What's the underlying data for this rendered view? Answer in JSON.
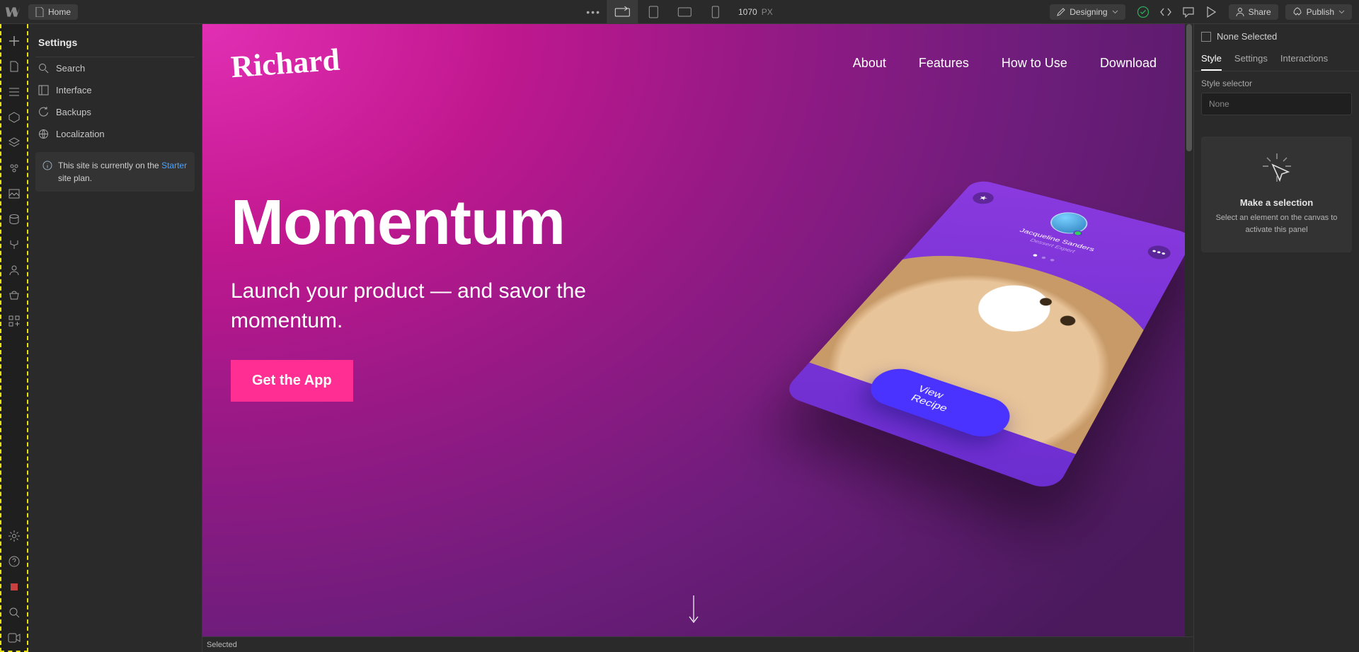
{
  "topbar": {
    "home_label": "Home",
    "breakpoint_value": "1070",
    "breakpoint_unit": "PX",
    "mode_label": "Designing",
    "share_label": "Share",
    "publish_label": "Publish"
  },
  "settings_panel": {
    "title": "Settings",
    "items": [
      {
        "icon": "search",
        "label": "Search"
      },
      {
        "icon": "interface",
        "label": "Interface"
      },
      {
        "icon": "backups",
        "label": "Backups"
      },
      {
        "icon": "globe",
        "label": "Localization"
      }
    ],
    "plan_prefix": "This site is currently on the ",
    "plan_link": "Starter",
    "plan_suffix": " site plan."
  },
  "canvas": {
    "brand": "Richard",
    "nav": [
      "About",
      "Features",
      "How to Use",
      "Download"
    ],
    "hero_title": "Momentum",
    "hero_sub": "Launch your product — and savor the momentum.",
    "cta": "Get the App",
    "phone": {
      "user_name": "Jacqueline Sanders",
      "user_role": "Dessert Expert",
      "button": "View Recipe"
    },
    "status_text": "Selected"
  },
  "rightpanel": {
    "selection": "None Selected",
    "tabs": [
      "Style",
      "Settings",
      "Interactions"
    ],
    "selector_label": "Style selector",
    "selector_value": "None",
    "empty_title": "Make a selection",
    "empty_sub": "Select an element on the canvas to activate this panel"
  }
}
